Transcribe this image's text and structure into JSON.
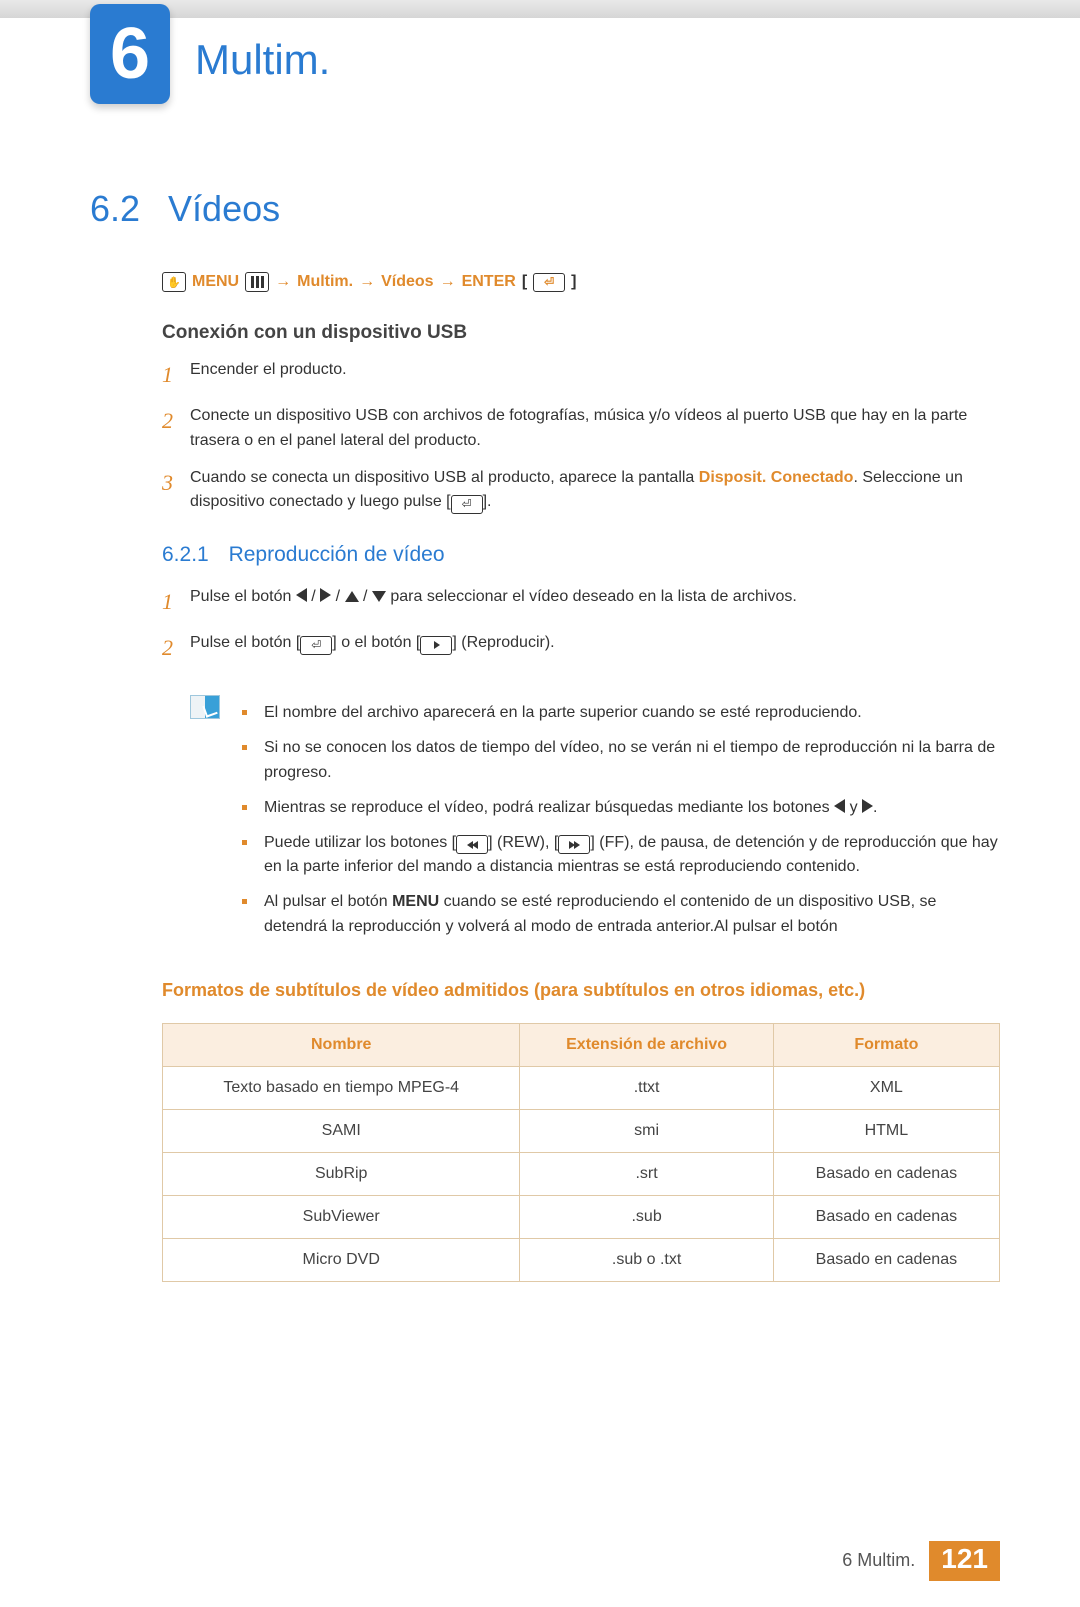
{
  "chapter": {
    "number": "6",
    "title": "Multim."
  },
  "section": {
    "number": "6.2",
    "title": "Vídeos"
  },
  "breadcrumb": {
    "menu": "MENU",
    "item1": "Multim.",
    "item2": "Vídeos",
    "enter": "ENTER"
  },
  "usb": {
    "heading": "Conexión con un dispositivo USB",
    "steps": [
      "Encender el producto.",
      "Conecte un dispositivo USB con archivos de fotografías, música y/o vídeos al puerto USB que hay en la parte trasera o en el panel lateral del producto.",
      {
        "pre": "Cuando se conecta un dispositivo USB al producto, aparece la pantalla ",
        "strong": "Disposit. Conectado",
        "post": ". Seleccione un dispositivo conectado y luego pulse [",
        "post2": "]."
      }
    ]
  },
  "subsection": {
    "number": "6.2.1",
    "title": "Reproducción de vídeo"
  },
  "play": {
    "steps": [
      {
        "pre": "Pulse el botón ",
        "post": " para seleccionar el vídeo deseado en la lista de archivos."
      },
      {
        "pre": "Pulse el botón [",
        "mid": "] o el botón [",
        "post": "] (Reproducir)."
      }
    ],
    "notes": [
      "El nombre del archivo aparecerá en la parte superior cuando se esté reproduciendo.",
      "Si no se conocen los datos de tiempo del vídeo, no se verán ni el tiempo de reproducción ni la barra de progreso.",
      {
        "pre": "Mientras se reproduce el vídeo, podrá realizar búsquedas mediante los botones ",
        "mid": " y ",
        "post": "."
      },
      {
        "pre": "Puede utilizar los botones [",
        "rew": "] (REW), [",
        "ff": "] (FF), de pausa, de detención y de reproducción que hay en la parte inferior del mando a distancia mientras se está reproduciendo contenido."
      },
      {
        "pre": "Al pulsar el botón ",
        "strong": "MENU",
        "post": " cuando se esté reproduciendo el contenido de un dispositivo USB, se detendrá la reproducción y volverá al modo de entrada anterior.Al pulsar el botón"
      }
    ]
  },
  "subtitles": {
    "heading": "Formatos de subtítulos de vídeo admitidos (para subtítulos en otros idiomas, etc.)",
    "columns": [
      "Nombre",
      "Extensión de archivo",
      "Formato"
    ],
    "rows": [
      [
        "Texto basado en tiempo MPEG-4",
        ".ttxt",
        "XML"
      ],
      [
        "SAMI",
        "smi",
        "HTML"
      ],
      [
        "SubRip",
        ".srt",
        "Basado en cadenas"
      ],
      [
        "SubViewer",
        ".sub",
        "Basado en cadenas"
      ],
      [
        "Micro DVD",
        ".sub o .txt",
        "Basado en cadenas"
      ]
    ]
  },
  "footer": {
    "label": "6 Multim.",
    "page": "121"
  },
  "chart_data": {
    "type": "table",
    "title": "Formatos de subtítulos de vídeo admitidos (para subtítulos en otros idiomas, etc.)",
    "columns": [
      "Nombre",
      "Extensión de archivo",
      "Formato"
    ],
    "rows": [
      [
        "Texto basado en tiempo MPEG-4",
        ".ttxt",
        "XML"
      ],
      [
        "SAMI",
        "smi",
        "HTML"
      ],
      [
        "SubRip",
        ".srt",
        "Basado en cadenas"
      ],
      [
        "SubViewer",
        ".sub",
        "Basado en cadenas"
      ],
      [
        "Micro DVD",
        ".sub o .txt",
        "Basado en cadenas"
      ]
    ]
  }
}
